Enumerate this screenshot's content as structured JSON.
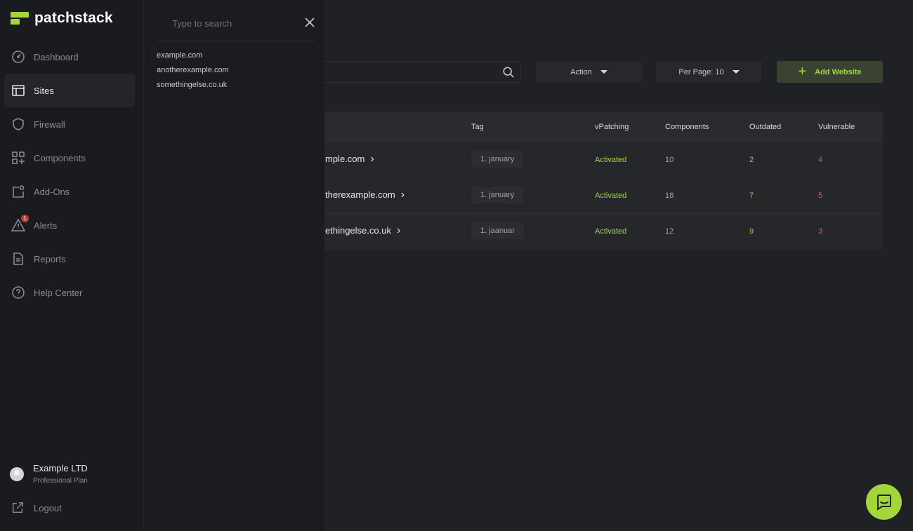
{
  "brand": {
    "name": "patchstack",
    "accent": "#a2d63a"
  },
  "sidebar": {
    "items": [
      {
        "label": "Dashboard",
        "icon": "dashboard-icon",
        "active": false
      },
      {
        "label": "Sites",
        "icon": "sites-icon",
        "active": true
      },
      {
        "label": "Firewall",
        "icon": "shield-icon",
        "active": false
      },
      {
        "label": "Components",
        "icon": "components-icon",
        "active": false
      },
      {
        "label": "Add-Ons",
        "icon": "addons-icon",
        "active": false
      },
      {
        "label": "Alerts",
        "icon": "alert-icon",
        "active": false,
        "badge": "1"
      },
      {
        "label": "Reports",
        "icon": "report-icon",
        "active": false
      },
      {
        "label": "Help Center",
        "icon": "help-icon",
        "active": false
      }
    ],
    "account": {
      "name": "Example LTD",
      "plan": "Professional Plan"
    },
    "logout_label": "Logout"
  },
  "search_panel": {
    "placeholder": "Type to search",
    "results": [
      "example.com",
      "anotherexample.com",
      "somethingelse.co.uk"
    ]
  },
  "toolbar": {
    "action_label": "Action",
    "per_page_label": "Per Page: 10",
    "add_label": "Add Website"
  },
  "table": {
    "headers": {
      "tag": "Tag",
      "vpatching": "vPatching",
      "components": "Components",
      "outdated": "Outdated",
      "vulnerable": "Vulnerable"
    },
    "rows": [
      {
        "site": "mple.com",
        "tag": "1. january",
        "vpatching": "Activated",
        "components": "10",
        "outdated": "2",
        "vulnerable": "4"
      },
      {
        "site": "therexample.com",
        "tag": "1. january",
        "vpatching": "Activated",
        "components": "18",
        "outdated": "7",
        "vulnerable": "5"
      },
      {
        "site": "ethingelse.co.uk",
        "tag": "1. jaanuar",
        "vpatching": "Activated",
        "components": "12",
        "outdated": "9",
        "vulnerable": "3"
      }
    ]
  },
  "chat": {
    "icon": "chat-icon"
  }
}
